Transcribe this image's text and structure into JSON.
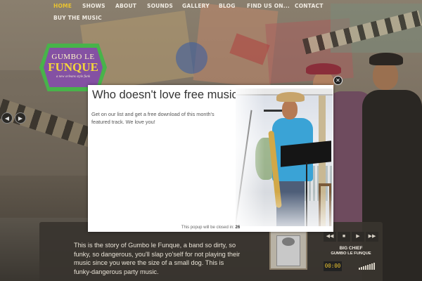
{
  "nav": {
    "items": [
      {
        "label": "HOME",
        "active": true
      },
      {
        "label": "SHOWS",
        "active": false
      },
      {
        "label": "ABOUT",
        "active": false
      },
      {
        "label": "SOUNDS",
        "active": false
      },
      {
        "label": "GALLERY",
        "active": false
      },
      {
        "label": "BLOG",
        "active": false
      },
      {
        "label": "FIND US ON...",
        "active": false
      },
      {
        "label": "CONTACT",
        "active": false
      },
      {
        "label": "BUY THE MUSIC",
        "active": false
      }
    ],
    "active_color": "#e8c230"
  },
  "logo": {
    "line1": "GUMBO LE",
    "line2": "FUNQUE",
    "tagline": "a new orleans style funk"
  },
  "slider": {
    "prev_icon": "chevron-left-icon",
    "next_icon": "chevron-right-icon"
  },
  "popup": {
    "title": "Who doesn't love free music?",
    "body": "Get on our list and get a free download of this month's featured track. We love you!",
    "footer_text": "This popup will be closed in:",
    "countdown": "26",
    "close_icon": "close-icon"
  },
  "story": {
    "text": "This is the story of Gumbo le Funque, a band so dirty, so funky, so dangerous, you'll slap yo'self for not playing their music since you were the size of a small dog. This is funky-dangerous party music."
  },
  "player": {
    "controls": [
      "rewind-icon",
      "stop-icon",
      "play-icon",
      "fast-forward-icon"
    ],
    "track": "BIG CHIEF",
    "band": "GUMBO LE FUNQUE",
    "time": "00:00"
  }
}
